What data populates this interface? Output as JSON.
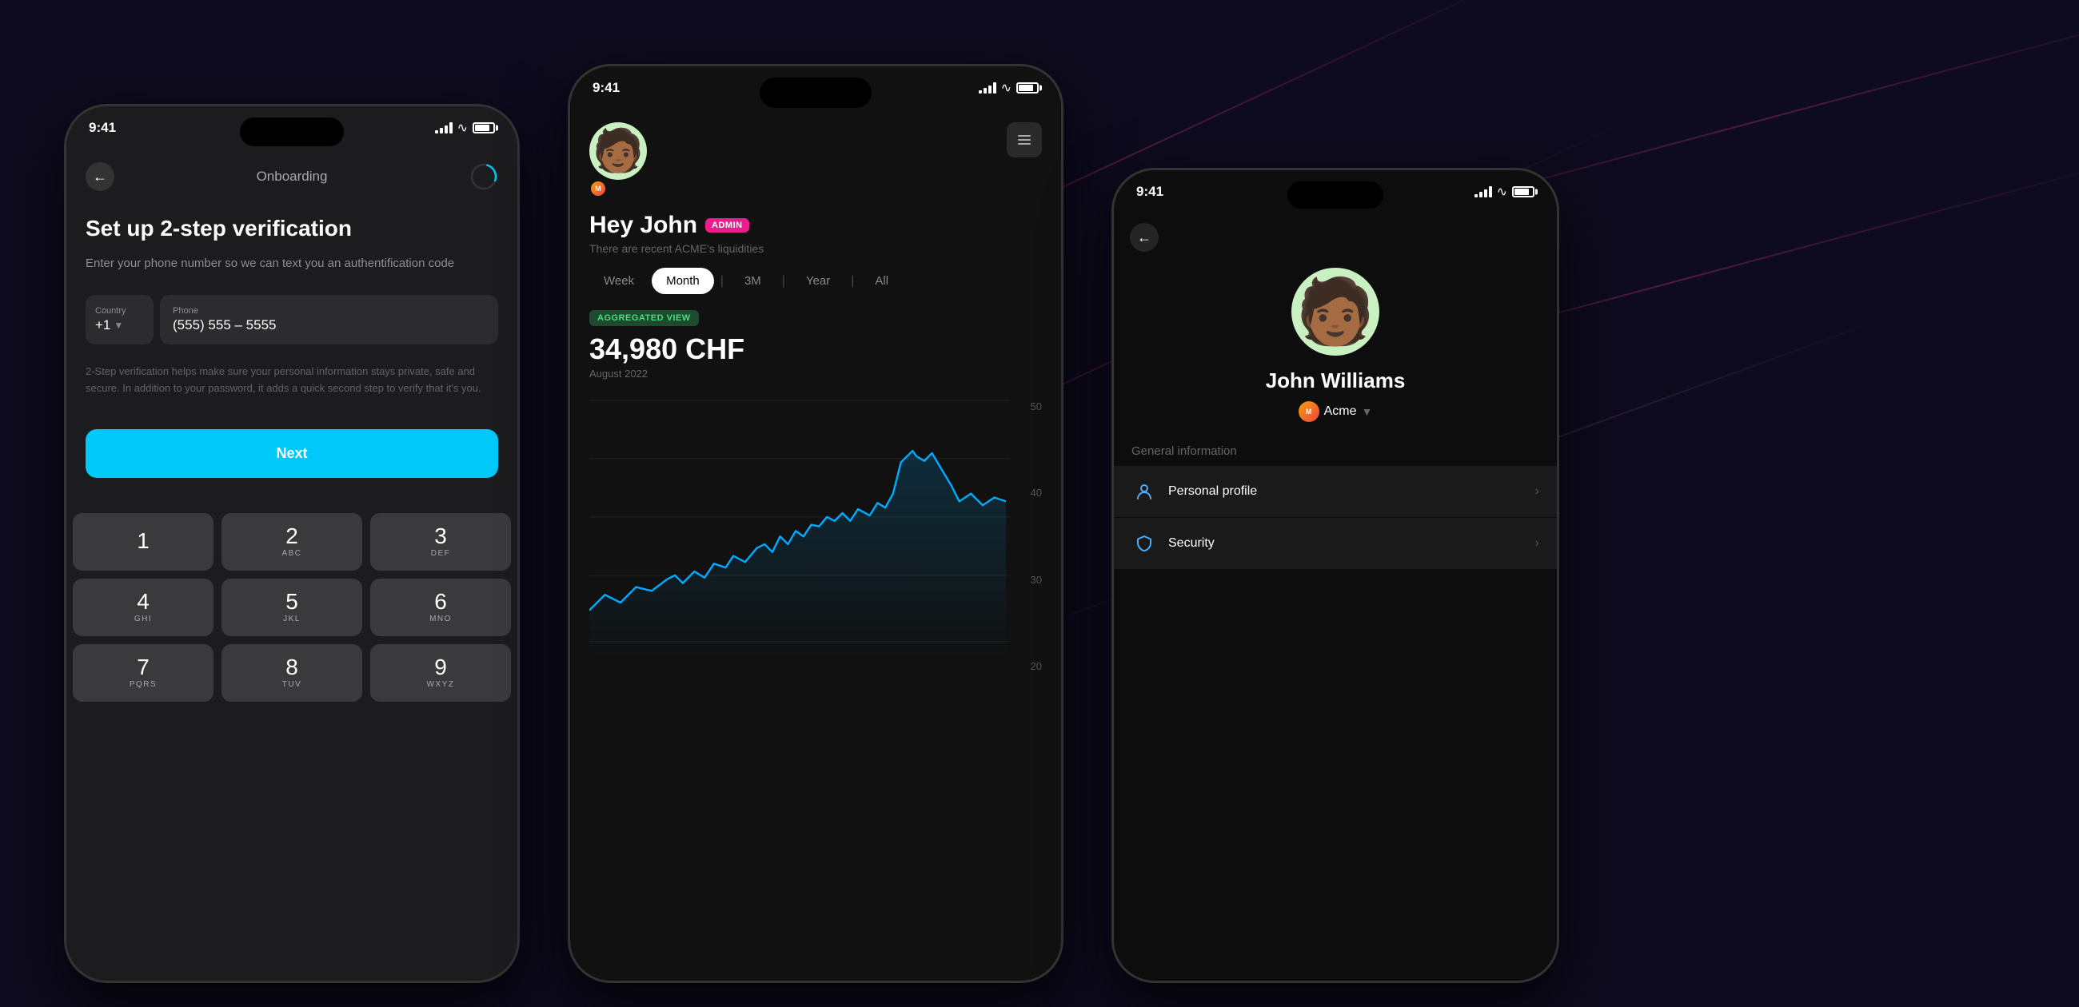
{
  "background": {
    "color": "#0e0b1e"
  },
  "phone1": {
    "status_time": "9:41",
    "header_label": "Onboarding",
    "title": "Set up 2-step verification",
    "description": "Enter your phone number so we can text you an authentification code",
    "country_label": "Country",
    "country_code": "+1",
    "phone_label": "Phone",
    "phone_placeholder": "(555) 555 – 5555",
    "info_text": "2-Step verification helps make sure your personal information stays private, safe and secure. In addition to your password, it adds a quick second step to verify that it's you.",
    "next_button": "Next",
    "keys": [
      {
        "num": "1",
        "letters": ""
      },
      {
        "num": "2",
        "letters": "ABC"
      },
      {
        "num": "3",
        "letters": "DEF"
      },
      {
        "num": "4",
        "letters": "GHI"
      },
      {
        "num": "5",
        "letters": "JKL"
      },
      {
        "num": "6",
        "letters": "MNO"
      },
      {
        "num": "7",
        "letters": "PQRS"
      },
      {
        "num": "8",
        "letters": "TUV"
      },
      {
        "num": "9",
        "letters": "WXYZ"
      }
    ]
  },
  "phone2": {
    "status_time": "9:41",
    "greeting": "Hey John",
    "admin_badge": "ADMIN",
    "subtitle": "There are recent ACME's liquidities",
    "tabs": [
      "Week",
      "Month",
      "3M",
      "Year",
      "All"
    ],
    "active_tab": "Month",
    "aggregated_label": "AGGREGATED VIEW",
    "chart_value": "34,980 CHF",
    "chart_date": "August 2022",
    "y_labels": [
      "50",
      "40",
      "30",
      "20"
    ],
    "chart_color": "#00aaff"
  },
  "phone3": {
    "status_time": "9:41",
    "user_name": "John Williams",
    "company_name": "Acme",
    "section_title": "General information",
    "menu_items": [
      {
        "icon": "person",
        "label": "Personal profile"
      },
      {
        "icon": "shield",
        "label": "Security"
      }
    ]
  }
}
